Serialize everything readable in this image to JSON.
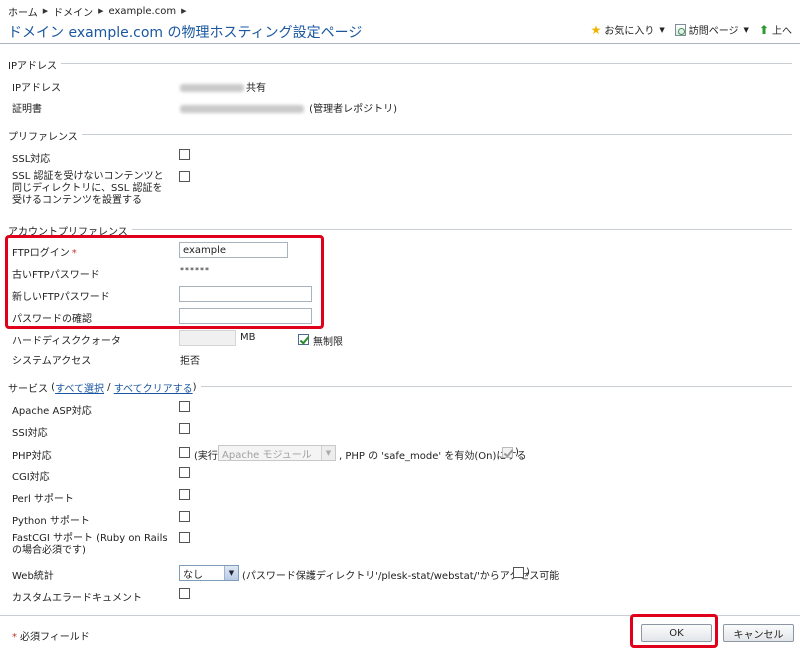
{
  "breadcrumb": [
    "ホーム",
    "ドメイン",
    "example.com"
  ],
  "page_title": "ドメイン example.com の物理ホスティング設定ページ",
  "toolbar": {
    "favorites": "お気に入り",
    "visited": "訪問ページ",
    "up": "上へ"
  },
  "ip_section": {
    "legend": "IPアドレス",
    "ip_label": "IPアドレス",
    "ip_suffix": "共有",
    "cert_label": "証明書",
    "cert_suffix": " (管理者レポジトリ)"
  },
  "pref_section": {
    "legend": "プリファレンス",
    "ssl_label": "SSL対応",
    "ssl_dir_label": "SSL 認証を受けないコンテンツと同じディレクトリに、SSL 認証を受けるコンテンツを設置する"
  },
  "account_section": {
    "legend": "アカウントプリファレンス",
    "ftp_login_label": "FTPログイン",
    "required_mark": "*",
    "ftp_login_value": "example",
    "old_password_label": "古いFTPパスワード",
    "old_password_value": "******",
    "new_password_label": "新しいFTPパスワード",
    "confirm_password_label": "パスワードの確認",
    "quota_label": "ハードディスククォータ",
    "quota_unit": "MB",
    "unlimited_label": "無制限",
    "unlimited_checked": true,
    "shell_label": "システムアクセス",
    "shell_value": "拒否"
  },
  "services_section": {
    "legend": "サービス",
    "select_all": "すべて選択",
    "clear_all": "すべてクリアする",
    "asp_label": "Apache ASP対応",
    "ssi_label": "SSI対応",
    "php_label": "PHP対応",
    "php_exec_label": "(実行",
    "php_mode_value": "Apache モジュール",
    "php_safe_mode_label": ", PHP の 'safe_mode' を有効(On)にする",
    "php_safe_mode_checked": true,
    "cgi_label": "CGI対応",
    "perl_label": "Perl サポート",
    "python_label": "Python サポート",
    "fastcgi_label": "FastCGI サポート (Ruby on Rails の場合必須です)",
    "webstat_label": "Web統計",
    "webstat_value": "なし",
    "webstat_note": "(パスワード保護ディレクトリ'/plesk-stat/webstat/'からアクセス可能",
    "custom_errors_label": "カスタムエラードキュメント"
  },
  "footer": {
    "required_note_mark": "*",
    "required_note": "必須フィールド",
    "ok_label": "OK",
    "cancel_label": "キャンセル"
  },
  "colors": {
    "title": "#1a57a0",
    "highlight": "#e0001b",
    "required": "#c0392b"
  }
}
